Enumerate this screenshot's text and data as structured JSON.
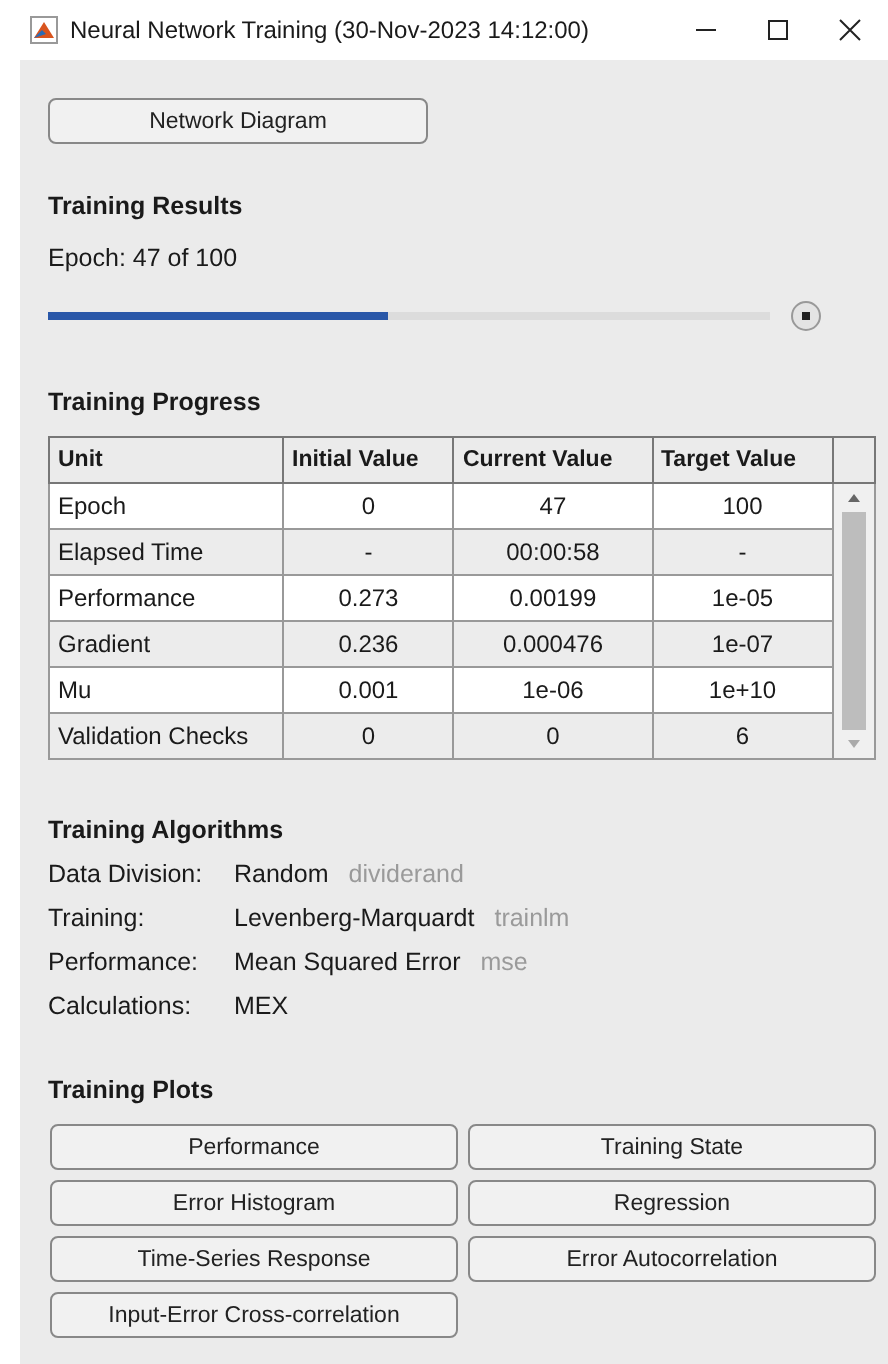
{
  "window": {
    "title": "Neural Network Training (30-Nov-2023 14:12:00)"
  },
  "network_button": "Network Diagram",
  "results": {
    "heading": "Training Results",
    "epoch_text": "Epoch: 47 of 100",
    "level": 0.47
  },
  "progress": {
    "heading": "Training Progress",
    "columns": [
      "Unit",
      "Initial Value",
      "Current Value",
      "Target Value"
    ],
    "rows": [
      [
        "Epoch",
        "0",
        "47",
        "100"
      ],
      [
        "Elapsed Time",
        "-",
        "00:00:58",
        "-"
      ],
      [
        "Performance",
        "0.273",
        "0.00199",
        "1e-05"
      ],
      [
        "Gradient",
        "0.236",
        "0.000476",
        "1e-07"
      ],
      [
        "Mu",
        "0.001",
        "1e-06",
        "1e+10"
      ],
      [
        "Validation Checks",
        "0",
        "0",
        "6"
      ]
    ]
  },
  "algorithms": {
    "heading": "Training Algorithms",
    "items": [
      {
        "label": "Data Division:",
        "value": "Random",
        "function": "dividerand"
      },
      {
        "label": "Training:",
        "value": "Levenberg-Marquardt",
        "function": "trainlm"
      },
      {
        "label": "Performance:",
        "value": "Mean Squared Error",
        "function": "mse"
      },
      {
        "label": "Calculations:",
        "value": "MEX"
      }
    ]
  },
  "plots": {
    "heading": "Training Plots",
    "buttons": [
      "Performance",
      "Training State",
      "Error Histogram",
      "Regression",
      "Time-Series Response",
      "Error Autocorrelation",
      "Input-Error Cross-correlation"
    ]
  }
}
